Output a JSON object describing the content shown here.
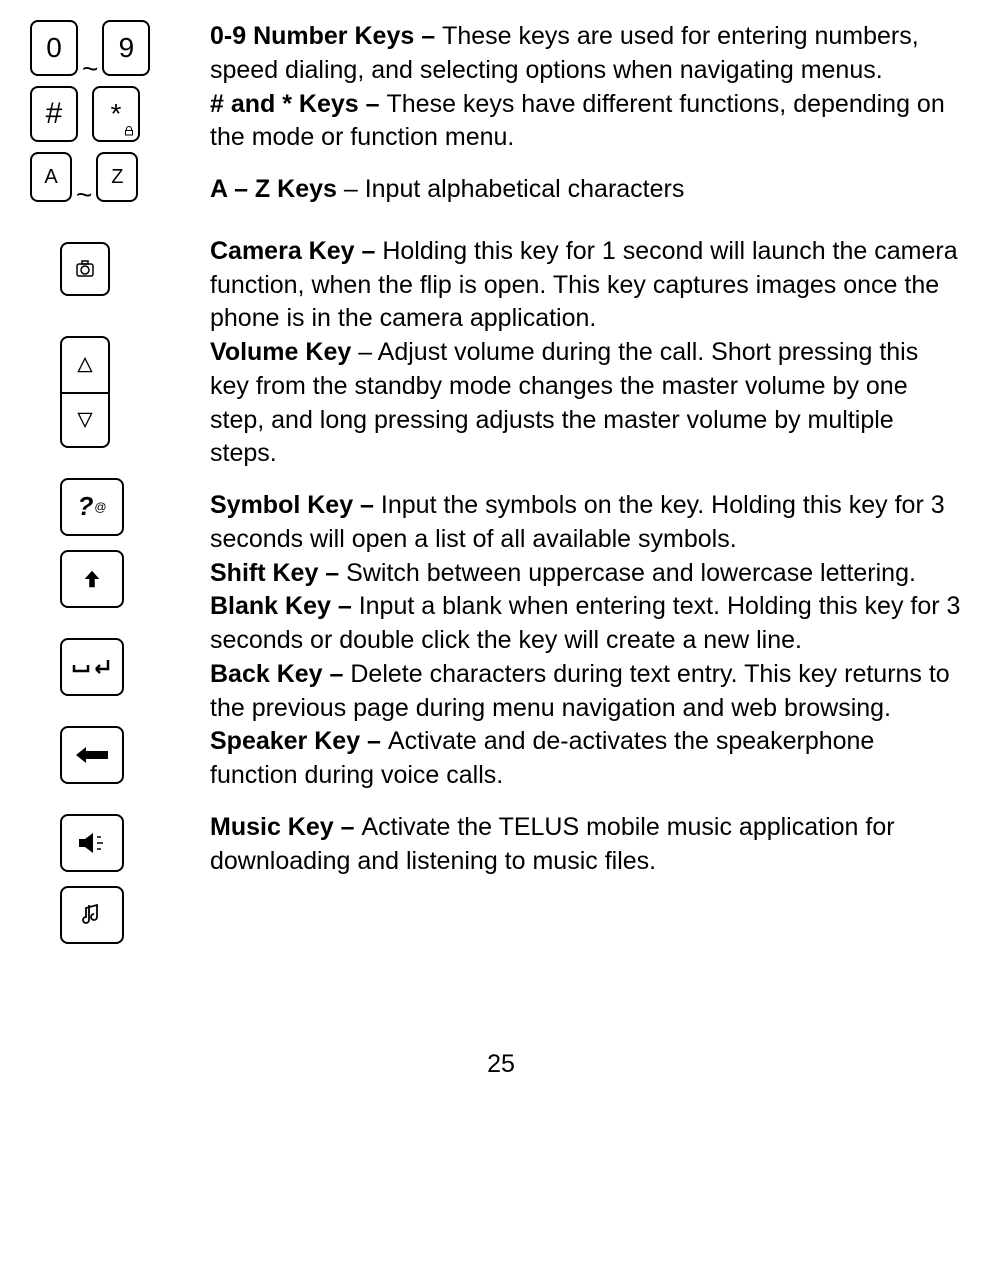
{
  "icons": {
    "zero": "0",
    "nine": "9",
    "tilde": "~",
    "hash": "#",
    "star": "*",
    "a": "A",
    "z": "Z",
    "question": "?",
    "at": "@"
  },
  "entries": [
    {
      "title": "0-9 Number Keys – ",
      "body": "These keys are used for entering numbers, speed dialing, and selecting options when navigating menus."
    },
    {
      "title": "# and * Keys – ",
      "body": "These keys have different functions, depending on the mode or function menu."
    },
    {
      "title": "A – Z Keys",
      "sep": " – ",
      "body": "Input alphabetical characters"
    },
    {
      "title": "Camera Key – ",
      "body": "Holding this key for 1 second will launch the camera function, when the flip is open. This key captures images once the phone is in the camera application."
    },
    {
      "title": "Volume Key",
      "sep": " – ",
      "body": "Adjust volume during the call. Short pressing this key from the standby mode changes the master volume by one step, and long pressing adjusts the master volume by multiple steps."
    },
    {
      "title": "Symbol Key – ",
      "body": "Input the symbols on the key. Holding this key for 3 seconds will open a list of all available symbols."
    },
    {
      "title": "Shift Key – ",
      "body": "Switch between uppercase and lowercase lettering."
    },
    {
      "title": "Blank Key – ",
      "body": "Input a blank when entering text. Holding this key for 3 seconds or double click the key will create a new line."
    },
    {
      "title": "Back Key – ",
      "body": "Delete characters during text entry. This key returns to the previous page during menu navigation and web browsing."
    },
    {
      "title": "Speaker Key – ",
      "body": "Activate and de-activates the speakerphone function during voice calls."
    },
    {
      "title": "Music Key – ",
      "body": "Activate the TELUS mobile music application for downloading and listening to music files."
    }
  ],
  "page_number": "25"
}
